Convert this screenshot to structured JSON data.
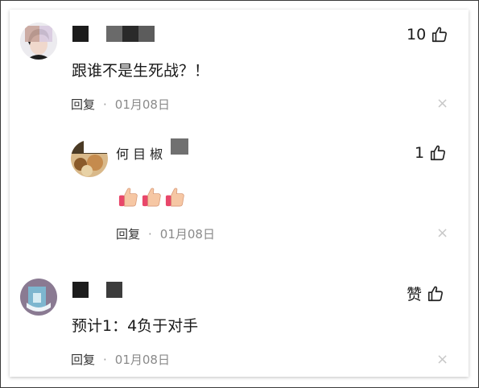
{
  "comments": [
    {
      "content": "跟谁不是生死战？！",
      "likes": "10",
      "reply_label": "回复",
      "separator": "·",
      "date": "01月08日",
      "close_glyph": "×"
    },
    {
      "name_visible": "何 目 椒",
      "likes": "1",
      "reply_label": "回复",
      "separator": "·",
      "date": "01月08日",
      "close_glyph": "×",
      "emoji": "thumbs-up-emoji"
    },
    {
      "content": "预计1：4负于对手",
      "likes": "赞",
      "reply_label": "回复",
      "separator": "·",
      "date": "01月08日",
      "close_glyph": "×"
    }
  ],
  "colors": {
    "frame_border": "#3a3a3a",
    "meta_gray": "#8a8a8a",
    "close_gray": "#c8c8c8",
    "emoji_skin": "#f6c7a4",
    "emoji_cuff": "#e8476a"
  },
  "icons": [
    "like-thumb-icon",
    "close-icon",
    "thumbs-up-emoji"
  ]
}
